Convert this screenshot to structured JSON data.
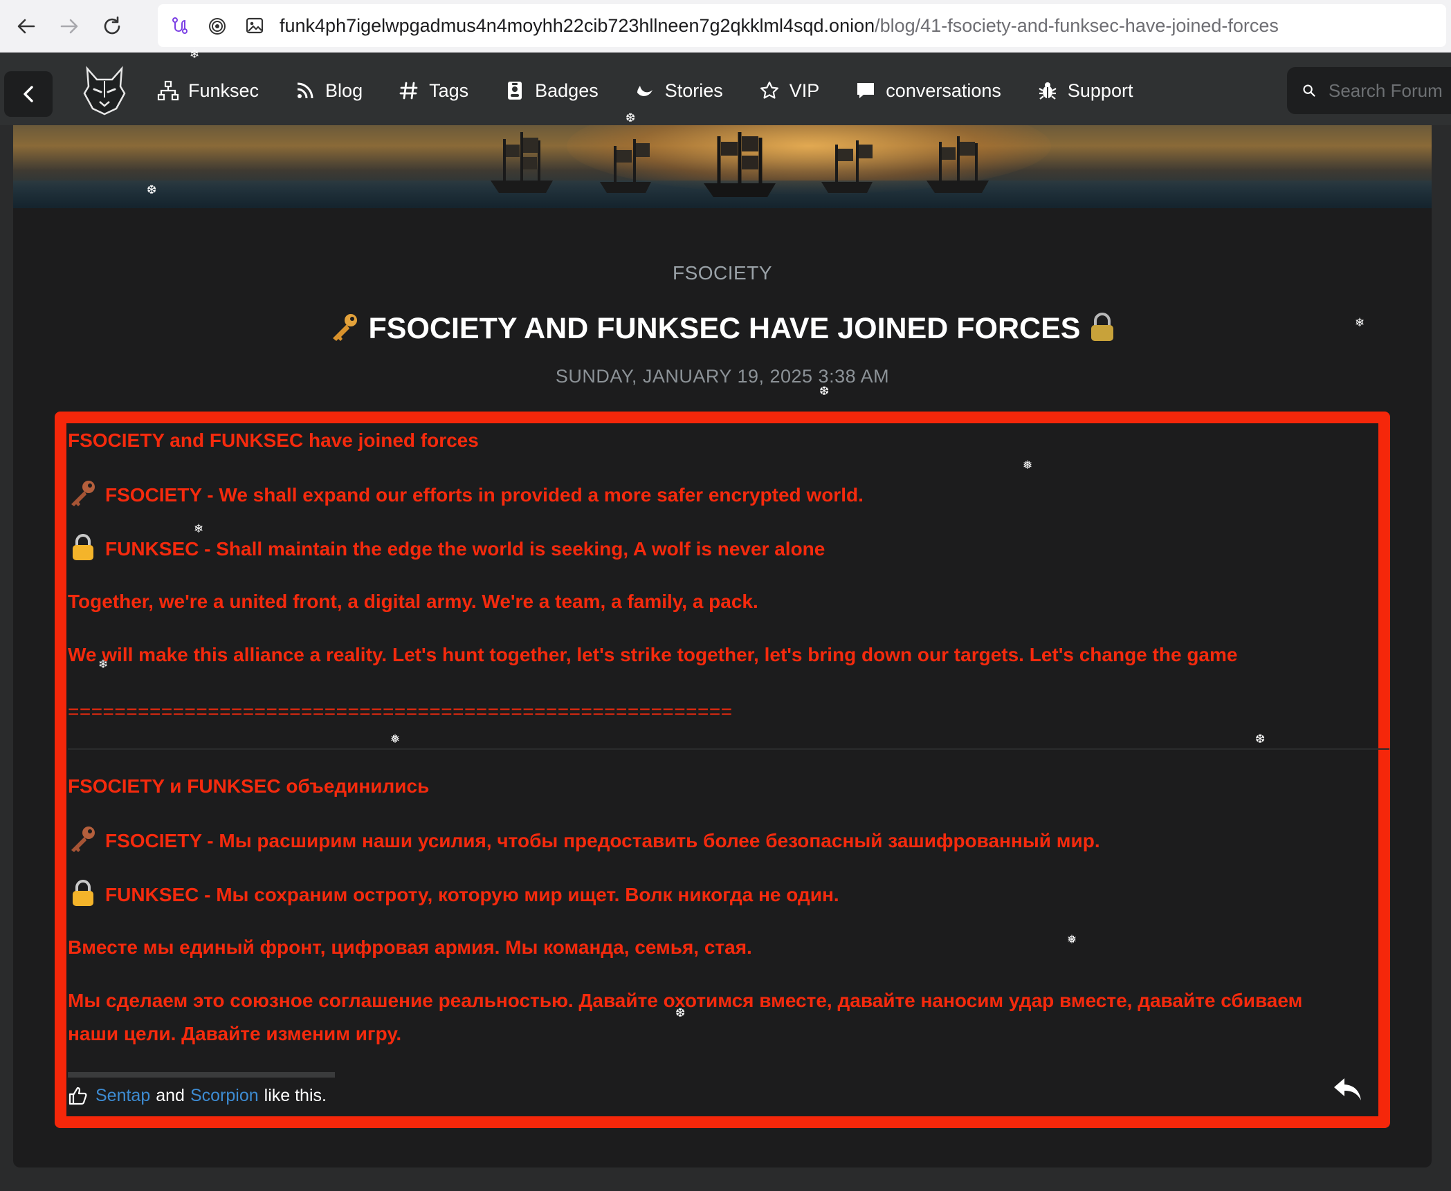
{
  "browser": {
    "url_host": "funk4ph7igelwpgadmus4n4moyhh22cib723hllneen7g2qkklml4sqd.onion",
    "url_path": "/blog/41-fsociety-and-funksec-have-joined-forces"
  },
  "nav": {
    "items": [
      {
        "label": "Funksec",
        "icon": "sitemap-icon"
      },
      {
        "label": "Blog",
        "icon": "feed-icon"
      },
      {
        "label": "Tags",
        "icon": "hashtag-icon"
      },
      {
        "label": "Badges",
        "icon": "id-badge-icon"
      },
      {
        "label": "Stories",
        "icon": "moon-icon"
      },
      {
        "label": "VIP",
        "icon": "star-icon"
      },
      {
        "label": "conversations",
        "icon": "chat-icon"
      },
      {
        "label": "Support",
        "icon": "bug-icon"
      }
    ],
    "search_placeholder": "Search Forum"
  },
  "post": {
    "category": "FSOCIETY",
    "title": "FSOCIETY AND FUNKSEC HAVE JOINED FORCES",
    "date": "SUNDAY, JANUARY 19, 2025 3:38 AM",
    "english": {
      "heading": "FSOCIETY and FUNKSEC have joined forces",
      "line_fsociety": "FSOCIETY - We shall expand our efforts in provided a more safer encrypted world.",
      "line_funksec": "FUNKSEC - Shall maintain the edge the world is seeking, A wolf is never alone",
      "line_together": "Together, we're a united front, a digital army. We're a team, a family, a pack.",
      "line_alliance": "We will make this alliance a reality. Let's hunt together, let's strike together, let's bring down our targets. Let's change the game",
      "divider": "========================================================="
    },
    "russian": {
      "heading": "FSOCIETY и FUNKSEC объединились",
      "line_fsociety": "FSOCIETY - Мы расширим наши усилия, чтобы предоставить более безопасный зашифрованный мир.",
      "line_funksec": "FUNKSEC - Мы сохраним остроту, которую мир ищет. Волк никогда не один.",
      "line_together": "Вместе мы единый фронт, цифровая армия. Мы команда, семья, стая.",
      "line_alliance_1": "Мы сделаем это союзное соглашение реальностью. Давайте охотимся вместе, давайте наносим удар вместе, давайте сбиваем",
      "line_alliance_2": "наши цели. Давайте изменим игру."
    },
    "likes": {
      "user1": "Sentap",
      "joiner": "and",
      "user2": "Scorpion",
      "suffix": "like this."
    }
  },
  "colors": {
    "accent_red": "#f5270a",
    "link_blue": "#3d8bd2",
    "background": "#1c1c1d"
  }
}
